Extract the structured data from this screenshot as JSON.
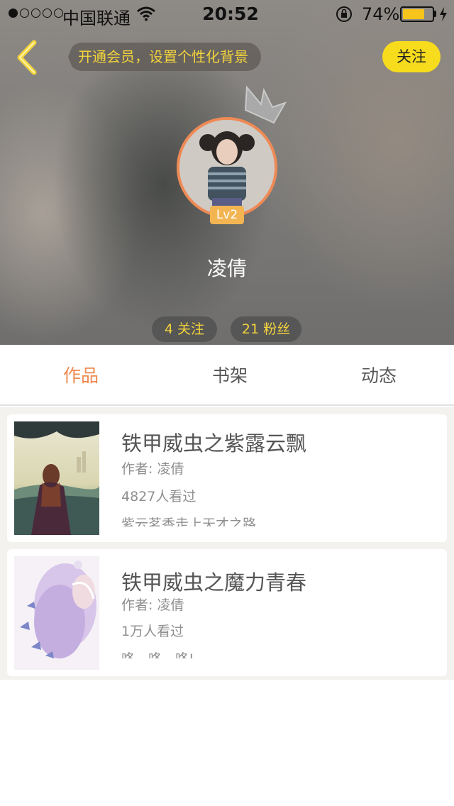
{
  "status_bar": {
    "carrier": "中国联通",
    "time": "20:52",
    "battery_percent_label": "74%",
    "battery_level": 0.74
  },
  "nav": {
    "back_icon": "chevron-left-icon",
    "vip_prompt": "开通会员，设置个性化背景",
    "follow_label": "关注"
  },
  "profile": {
    "level": "Lv2",
    "name": "凌倩",
    "following_label": "4 关注",
    "fans_label": "21 粉丝"
  },
  "tabs": [
    {
      "label": "作品",
      "active": true
    },
    {
      "label": "书架",
      "active": false
    },
    {
      "label": "动态",
      "active": false
    }
  ],
  "works": [
    {
      "title": "铁甲威虫之紫露云飘",
      "author": "作者: 凌倩",
      "views": "4827人看过",
      "description": "紫云茗香走上天才之路"
    },
    {
      "title": "铁甲威虫之魔力青春",
      "author": "作者: 凌倩",
      "views": "1万人看过",
      "description": "咚、咚、咚!"
    }
  ],
  "colors": {
    "accent_orange": "#ee8a4e",
    "follow_yellow": "#f7dc1d",
    "stat_yellow": "#f2d33c",
    "level_badge": "#f2b552"
  }
}
